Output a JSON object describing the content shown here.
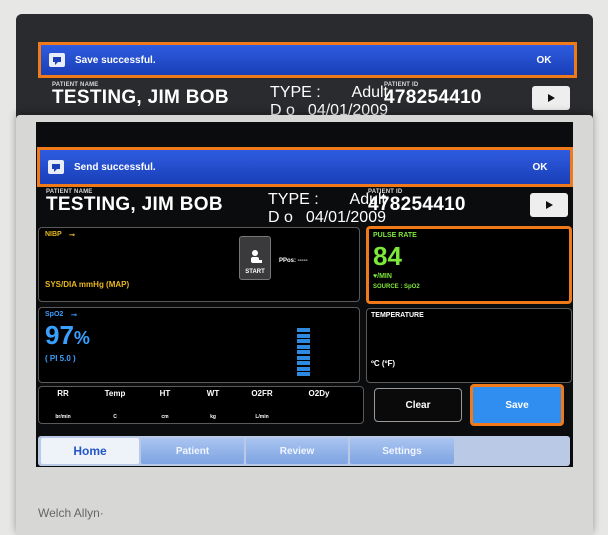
{
  "back_screen": {
    "banner": {
      "message": "Save successful.",
      "ok": "OK"
    },
    "patient": {
      "name_label": "PATIENT NAME",
      "name": "TESTING, JIM BOB",
      "type_label": "TYPE :",
      "type_value": "Adult",
      "dob_label": "D o B :",
      "dob_value": "04/01/2009",
      "id_label": "PATIENT ID",
      "id_value": "478254410"
    }
  },
  "front_screen": {
    "banner": {
      "message": "Send successful.",
      "ok": "OK"
    },
    "patient": {
      "name_label": "PATIENT NAME",
      "name": "TESTING, JIM BOB",
      "type_label": "TYPE :",
      "type_value": "Adult",
      "dob_label": "D o B :",
      "dob_value": "04/01/2009",
      "id_label": "PATIENT ID",
      "id_value": "478254410"
    },
    "nibp": {
      "label": "NIBP",
      "units": "SYS/DIA mmHg (MAP)",
      "start_label": "START",
      "ppos_label": "PPos: -----"
    },
    "pulse": {
      "label": "PULSE RATE",
      "value": "84",
      "unit": "♥/MIN",
      "source": "SOURCE : SpO2"
    },
    "spo2": {
      "label": "SpO2",
      "value": "97",
      "unit": "%",
      "pi": "( PI 5.0 )",
      "signal_level": 0.9
    },
    "temperature": {
      "label": "TEMPERATURE",
      "unit": "ºC (ºF)"
    },
    "vitals_row": [
      {
        "name": "RR",
        "unit": "br/min"
      },
      {
        "name": "Temp",
        "unit": "C"
      },
      {
        "name": "HT",
        "unit": "cm"
      },
      {
        "name": "WT",
        "unit": "kg"
      },
      {
        "name": "O2FR",
        "unit": "L/min"
      },
      {
        "name": "O2Dy",
        "unit": ""
      }
    ],
    "clear_button": "Clear",
    "save_button": "Save",
    "tabs": [
      "Home",
      "Patient",
      "Review",
      "Settings"
    ],
    "active_tab": "Home"
  },
  "brand": "Welch Allyn·",
  "colors": {
    "banner_blue": "#2e5ce0",
    "highlight_orange": "#f07a1a",
    "nibp_yellow": "#e9b81f",
    "pulse_green": "#7de83a",
    "spo2_blue": "#3aa0ff",
    "save_blue": "#2f8ef0"
  }
}
